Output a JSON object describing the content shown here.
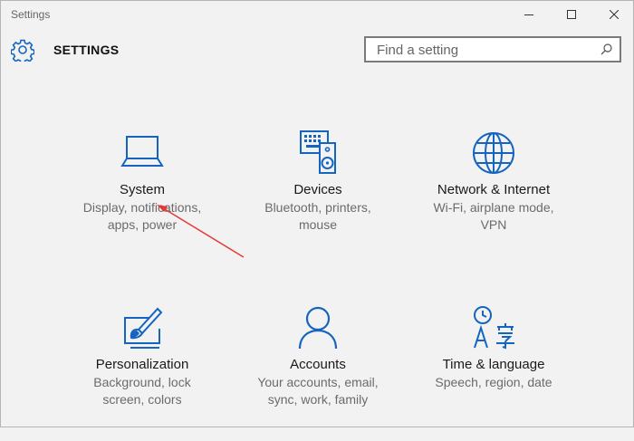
{
  "window": {
    "title": "Settings",
    "controls": {
      "minimize": "minimize",
      "maximize": "maximize",
      "close": "close"
    }
  },
  "header": {
    "title": "SETTINGS",
    "search_placeholder": "Find a setting"
  },
  "tiles": [
    {
      "name": "System",
      "desc_line1": "Display, notifications,",
      "desc_line2": "apps, power",
      "icon": "laptop-icon"
    },
    {
      "name": "Devices",
      "desc_line1": "Bluetooth, printers,",
      "desc_line2": "mouse",
      "icon": "devices-icon"
    },
    {
      "name": "Network & Internet",
      "desc_line1": "Wi-Fi, airplane mode,",
      "desc_line2": "VPN",
      "icon": "globe-icon"
    },
    {
      "name": "Personalization",
      "desc_line1": "Background, lock",
      "desc_line2": "screen, colors",
      "icon": "paint-brush-icon"
    },
    {
      "name": "Accounts",
      "desc_line1": "Your accounts, email,",
      "desc_line2": "sync, work, family",
      "icon": "person-icon"
    },
    {
      "name": "Time & language",
      "desc_line1": "Speech, region, date",
      "desc_line2": "",
      "icon": "time-language-icon"
    }
  ],
  "colors": {
    "accent": "#1565c0",
    "annotation_arrow": "#e53935"
  }
}
